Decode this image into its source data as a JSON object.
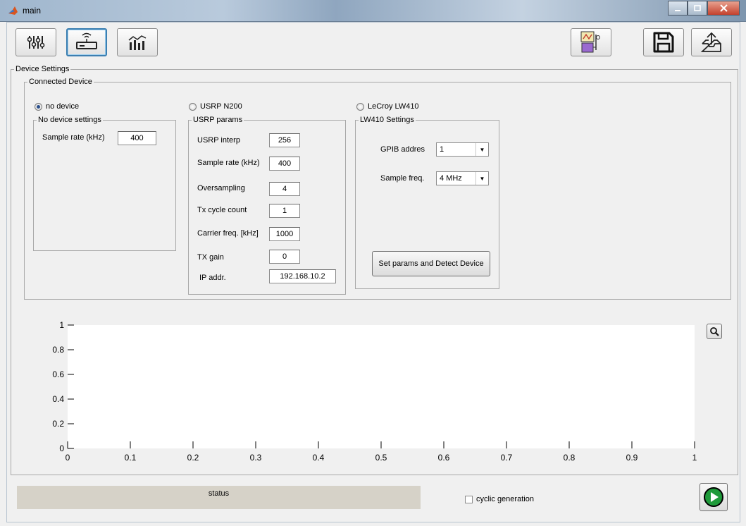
{
  "window": {
    "title": "main"
  },
  "toolbar": {
    "left_buttons": [
      "sliders-icon",
      "router-icon",
      "chart-icon"
    ],
    "right_buttons": [
      "generator-icon",
      "save-icon",
      "export-icon"
    ]
  },
  "device_settings": {
    "title": "Device Settings",
    "connected_device": {
      "title": "Connected Device",
      "radios": [
        {
          "label": "no device",
          "selected": true
        },
        {
          "label": "USRP N200",
          "selected": false
        },
        {
          "label": "LeCroy LW410",
          "selected": false
        }
      ]
    },
    "no_device": {
      "title": "No device settings",
      "sample_rate_label": "Sample rate (kHz)",
      "sample_rate_value": "400"
    },
    "usrp": {
      "title": "USRP params",
      "fields": [
        {
          "label": "USRP interp",
          "value": "256"
        },
        {
          "label": "Sample rate (kHz)",
          "value": "400"
        },
        {
          "label": "Oversampling",
          "value": "4"
        },
        {
          "label": "Tx cycle count",
          "value": "1"
        },
        {
          "label": "Carrier freq. [kHz]",
          "value": "1000"
        },
        {
          "label": "TX gain",
          "value": "0"
        },
        {
          "label": "IP addr.",
          "value": "192.168.10.2"
        }
      ]
    },
    "lw410": {
      "title": "LW410 Settings",
      "gpib_label": "GPIB addres",
      "gpib_value": "1",
      "sample_freq_label": "Sample freq.",
      "sample_freq_value": "4 MHz",
      "detect_button": "Set params and Detect Device"
    }
  },
  "plot": {
    "x_ticks": [
      "0",
      "0.1",
      "0.2",
      "0.3",
      "0.4",
      "0.5",
      "0.6",
      "0.7",
      "0.8",
      "0.9",
      "1"
    ],
    "y_ticks": [
      "0",
      "0.2",
      "0.4",
      "0.6",
      "0.8",
      "1"
    ]
  },
  "footer": {
    "status_text": "status",
    "cyclic_label": "cyclic generation",
    "cyclic_checked": false
  },
  "colors": {
    "accent": "#3c7fb1",
    "play_green": "#1f9a3a",
    "status_bg": "#d6d2c8"
  }
}
